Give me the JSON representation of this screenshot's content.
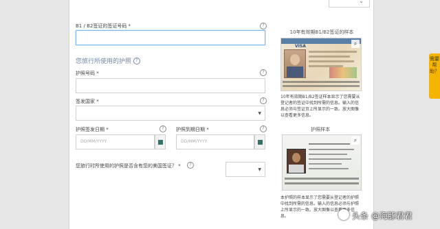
{
  "form": {
    "visa_number_label": "B1 / B2签证的签证号码 *",
    "passport_section_title": "您旅行所使用的护照",
    "passport_number_label": "护照号码 *",
    "issuing_country_label": "签发国家 *",
    "issue_date_label": "护照签发日期 *",
    "expiry_date_label": "护照到期日期 *",
    "date_placeholder": "DD/MM/YYYY",
    "contains_visa_question": "您旅行时所使用的护照是否含有您的美国签证？ *"
  },
  "help_glyph": "?",
  "sidebar": {
    "visa_sample_title": "10年有效期B1/B2签证的样本",
    "visa_sample_desc": "10年有效期B1/B2签证样本显示了您需要从登记者的签证中找到所需的信息。输入的信息必须与签证页上所显示的一致。放大图像以查看更多信息。",
    "passport_sample_title": "护照样本",
    "passport_sample_desc": "本护照的样本显示了您需要从登记者的护照中找到所需的信息。输入的信息必须与护照上所显示的一致。放大图像以查看更多信息。",
    "visa_word": "VISA",
    "zoom_icon": "zoom-icon"
  },
  "help_tab": {
    "label": "需要帮助？"
  },
  "watermark": {
    "text": "头条 @海豚君君"
  },
  "colors": {
    "accent": "#7fb2e5",
    "help_tab": "#f4b400",
    "section_title": "#6f86a8"
  }
}
